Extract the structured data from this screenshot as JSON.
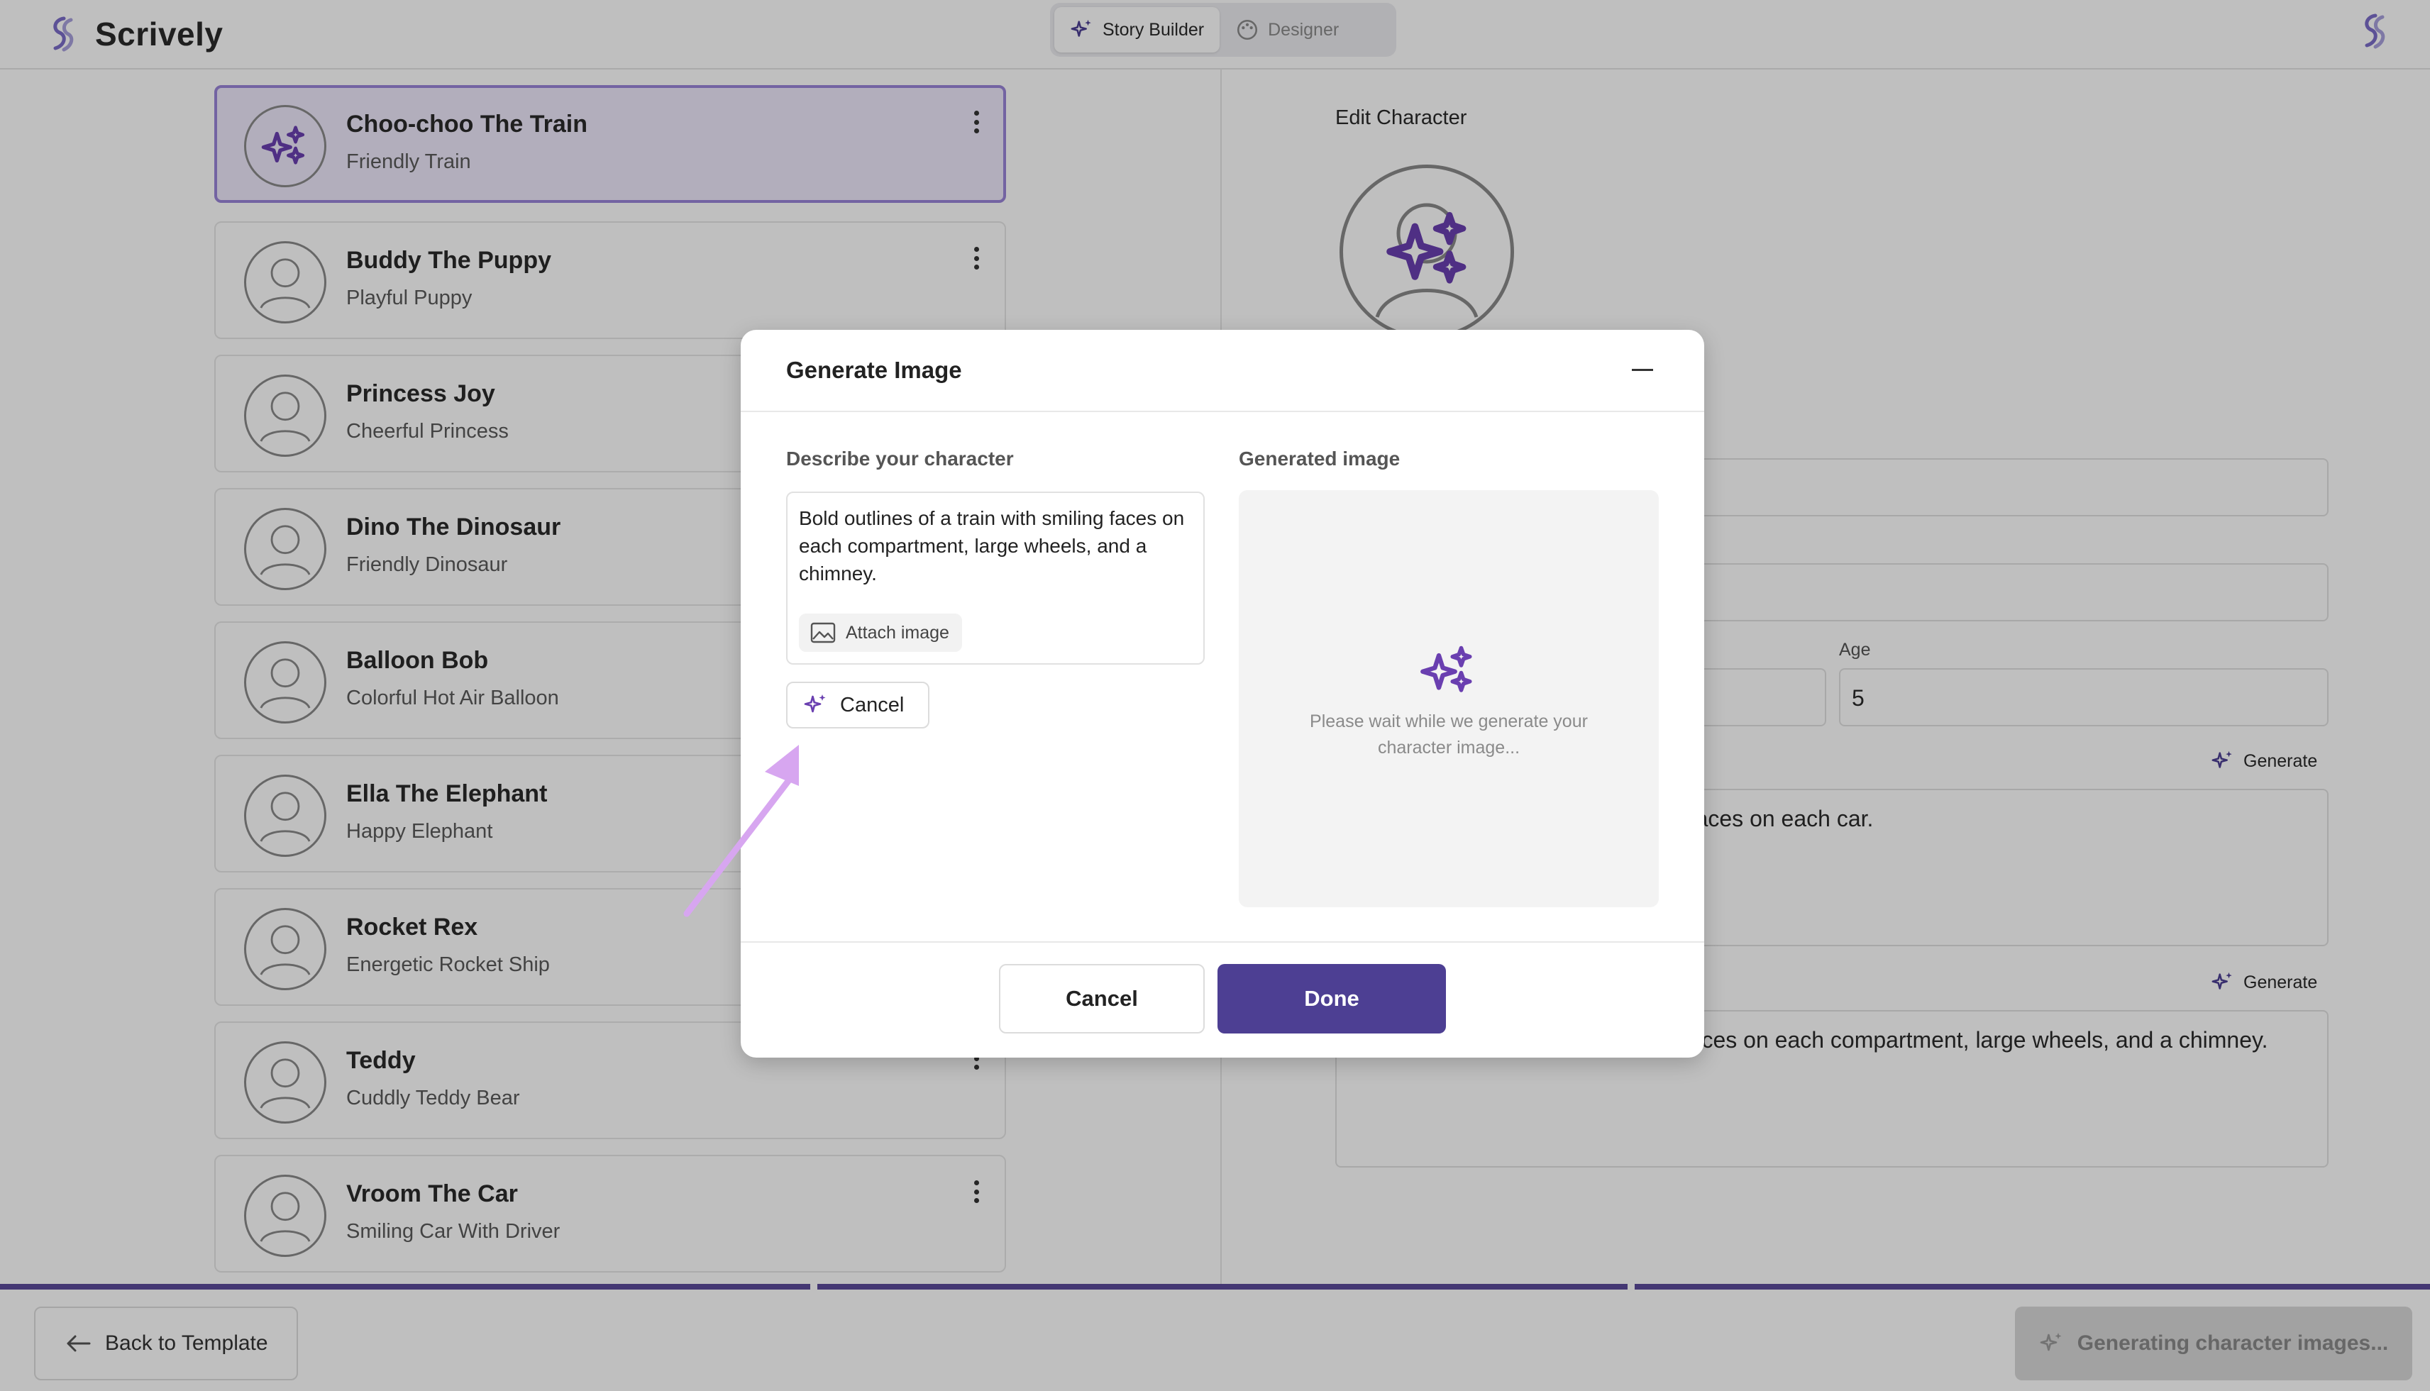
{
  "app": {
    "name": "Scrively"
  },
  "header": {
    "tabs": [
      {
        "label": "Story Builder",
        "active": true
      },
      {
        "label": "Designer",
        "active": false
      }
    ]
  },
  "characters": [
    {
      "name": "Choo-choo The Train",
      "subtitle": "Friendly Train",
      "selected": true
    },
    {
      "name": "Buddy The Puppy",
      "subtitle": "Playful Puppy"
    },
    {
      "name": "Princess Joy",
      "subtitle": "Cheerful Princess"
    },
    {
      "name": "Dino The Dinosaur",
      "subtitle": "Friendly Dinosaur"
    },
    {
      "name": "Balloon Bob",
      "subtitle": "Colorful Hot Air Balloon"
    },
    {
      "name": "Ella The Elephant",
      "subtitle": "Happy Elephant"
    },
    {
      "name": "Rocket Rex",
      "subtitle": "Energetic Rocket Ship"
    },
    {
      "name": "Teddy",
      "subtitle": "Cuddly Teddy Bear"
    },
    {
      "name": "Vroom The Car",
      "subtitle": "Smiling Car With Driver"
    }
  ],
  "edit_panel": {
    "title": "Edit Character",
    "age_label": "Age",
    "age_value": "5",
    "generate_label": "Generate",
    "field1_visible_text": "g faces on each car.",
    "field2_visible_text": ", faces on each compartment, large wheels, and a chimney."
  },
  "footer": {
    "back_label": "Back to Template",
    "generating_label": "Generating character images..."
  },
  "modal": {
    "title": "Generate Image",
    "describe_label": "Describe your character",
    "description": "Bold outlines of a train with smiling faces on each compartment, large wheels, and a chimney.",
    "attach_label": "Attach image",
    "inline_cancel_label": "Cancel",
    "generated_label": "Generated image",
    "wait_text": "Please wait while we generate your character image...",
    "cancel_label": "Cancel",
    "done_label": "Done"
  },
  "colors": {
    "accent": "#4d3f93",
    "sparkle": "#6a3fb0",
    "annotation_arrow": "#d7a6f0"
  }
}
